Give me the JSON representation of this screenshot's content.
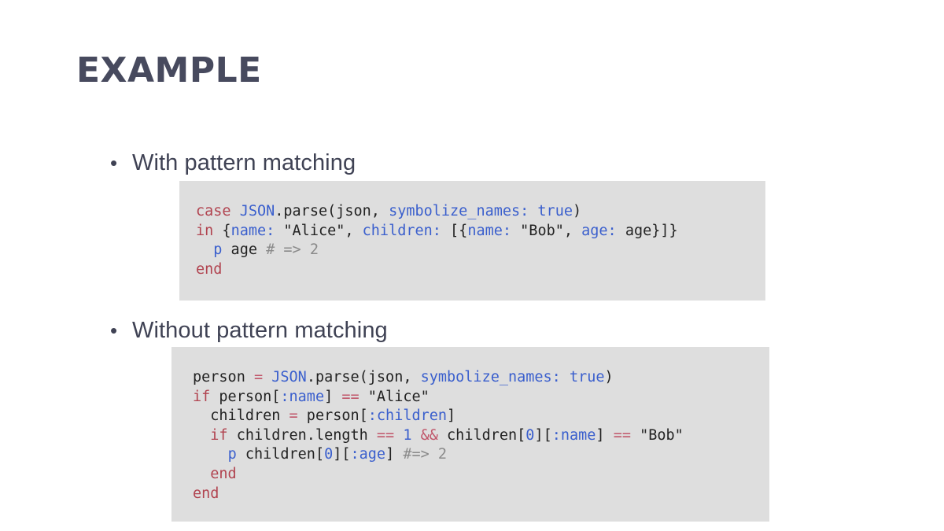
{
  "slide": {
    "title": "EXAMPLE",
    "title_color": "#474a5e",
    "background_color": "#ffffff",
    "code_block_background": "#dedede"
  },
  "bullets": [
    {
      "marker": "•",
      "label": "With pattern matching"
    },
    {
      "marker": "•",
      "label": "Without pattern matching"
    }
  ],
  "code_blocks": [
    {
      "id": "with-pattern-matching",
      "language": "ruby",
      "plain_text": "case JSON.parse(json, symbolize_names: true)\nin {name: \"Alice\", children: [{name: \"Bob\", age: age}]}\n  p age # => 2\nend",
      "lines": [
        {
          "tokens": [
            {
              "text": "case ",
              "type": "keyword"
            },
            {
              "text": "JSON",
              "type": "class"
            },
            {
              "text": ".parse(json, ",
              "type": "plain"
            },
            {
              "text": "symbolize_names:",
              "type": "symbol"
            },
            {
              "text": " ",
              "type": "plain"
            },
            {
              "text": "true",
              "type": "symbol"
            },
            {
              "text": ")",
              "type": "plain"
            }
          ]
        },
        {
          "tokens": [
            {
              "text": "in ",
              "type": "keyword"
            },
            {
              "text": "{",
              "type": "plain"
            },
            {
              "text": "name:",
              "type": "symbol"
            },
            {
              "text": " \"Alice\", ",
              "type": "plain"
            },
            {
              "text": "children:",
              "type": "symbol"
            },
            {
              "text": " [{",
              "type": "plain"
            },
            {
              "text": "name:",
              "type": "symbol"
            },
            {
              "text": " \"Bob\", ",
              "type": "plain"
            },
            {
              "text": "age:",
              "type": "symbol"
            },
            {
              "text": " age}]}",
              "type": "plain"
            }
          ]
        },
        {
          "tokens": [
            {
              "text": "  ",
              "type": "plain"
            },
            {
              "text": "p",
              "type": "symbol"
            },
            {
              "text": " age ",
              "type": "plain"
            },
            {
              "text": "# => 2",
              "type": "comment"
            }
          ]
        },
        {
          "tokens": [
            {
              "text": "end",
              "type": "keyword"
            }
          ]
        }
      ]
    },
    {
      "id": "without-pattern-matching",
      "language": "ruby",
      "plain_text": "person = JSON.parse(json, symbolize_names: true)\nif person[:name] == \"Alice\"\n  children = person[:children]\n  if children.length == 1 && children[0][:name] == \"Bob\"\n    p children[0][:age] #=> 2\n  end\nend",
      "lines": [
        {
          "tokens": [
            {
              "text": "person ",
              "type": "plain"
            },
            {
              "text": "=",
              "type": "operator"
            },
            {
              "text": " ",
              "type": "plain"
            },
            {
              "text": "JSON",
              "type": "class"
            },
            {
              "text": ".parse(json, ",
              "type": "plain"
            },
            {
              "text": "symbolize_names:",
              "type": "symbol"
            },
            {
              "text": " ",
              "type": "plain"
            },
            {
              "text": "true",
              "type": "symbol"
            },
            {
              "text": ")",
              "type": "plain"
            }
          ]
        },
        {
          "tokens": [
            {
              "text": "if",
              "type": "keyword"
            },
            {
              "text": " person[",
              "type": "plain"
            },
            {
              "text": ":name",
              "type": "symbol"
            },
            {
              "text": "] ",
              "type": "plain"
            },
            {
              "text": "==",
              "type": "operator"
            },
            {
              "text": " \"Alice\"",
              "type": "plain"
            }
          ]
        },
        {
          "tokens": [
            {
              "text": "  children ",
              "type": "plain"
            },
            {
              "text": "=",
              "type": "operator"
            },
            {
              "text": " person[",
              "type": "plain"
            },
            {
              "text": ":children",
              "type": "symbol"
            },
            {
              "text": "]",
              "type": "plain"
            }
          ]
        },
        {
          "tokens": [
            {
              "text": "  ",
              "type": "plain"
            },
            {
              "text": "if",
              "type": "keyword"
            },
            {
              "text": " children.length ",
              "type": "plain"
            },
            {
              "text": "==",
              "type": "operator"
            },
            {
              "text": " ",
              "type": "plain"
            },
            {
              "text": "1",
              "type": "number"
            },
            {
              "text": " ",
              "type": "plain"
            },
            {
              "text": "&&",
              "type": "operator"
            },
            {
              "text": " children[",
              "type": "plain"
            },
            {
              "text": "0",
              "type": "number"
            },
            {
              "text": "][",
              "type": "plain"
            },
            {
              "text": ":name",
              "type": "symbol"
            },
            {
              "text": "] ",
              "type": "plain"
            },
            {
              "text": "==",
              "type": "operator"
            },
            {
              "text": " \"Bob\"",
              "type": "plain"
            }
          ]
        },
        {
          "tokens": [
            {
              "text": "    ",
              "type": "plain"
            },
            {
              "text": "p",
              "type": "symbol"
            },
            {
              "text": " children[",
              "type": "plain"
            },
            {
              "text": "0",
              "type": "number"
            },
            {
              "text": "][",
              "type": "plain"
            },
            {
              "text": ":age",
              "type": "symbol"
            },
            {
              "text": "] ",
              "type": "plain"
            },
            {
              "text": "#=> 2",
              "type": "comment"
            }
          ]
        },
        {
          "tokens": [
            {
              "text": "  ",
              "type": "plain"
            },
            {
              "text": "end",
              "type": "keyword"
            }
          ]
        },
        {
          "tokens": [
            {
              "text": "end",
              "type": "keyword"
            }
          ]
        }
      ]
    }
  ]
}
